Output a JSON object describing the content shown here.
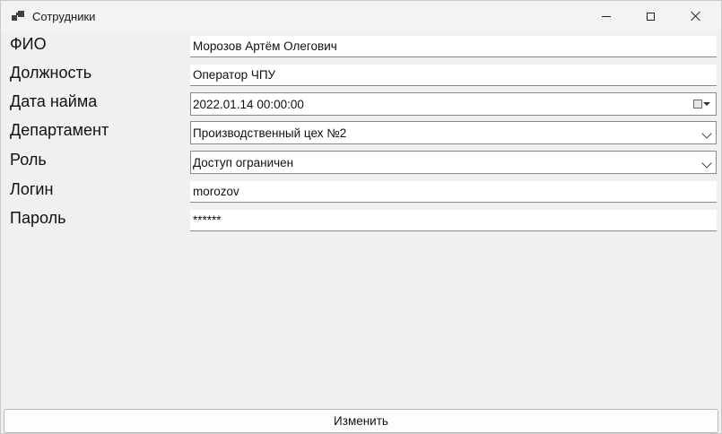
{
  "window": {
    "title": "Сотрудники"
  },
  "form": {
    "fio_label": "ФИО",
    "fio_value": "Морозов Артём Олегович",
    "position_label": "Должность",
    "position_value": "Оператор ЧПУ",
    "hire_date_label": "Дата найма",
    "hire_date_value": "2022.01.14 00:00:00",
    "department_label": "Департамент",
    "department_value": "Производственный цех №2",
    "role_label": "Роль",
    "role_value": "Доступ ограничен",
    "login_label": "Логин",
    "login_value": "morozov",
    "password_label": "Пароль",
    "password_value": "******"
  },
  "actions": {
    "edit_label": "Изменить"
  }
}
